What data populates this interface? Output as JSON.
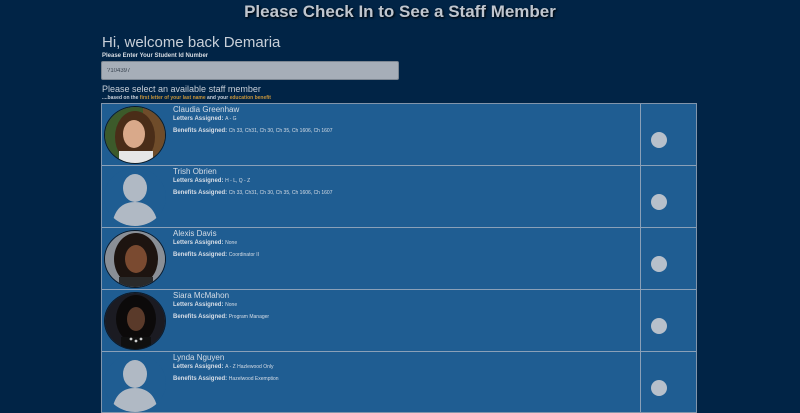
{
  "header": {
    "title": "Please Check In to See a Staff Member"
  },
  "welcome": {
    "text": "Hi, welcome back Demaria"
  },
  "student_id": {
    "label": "Please Enter Your Student Id Number",
    "value": "?104397"
  },
  "selection": {
    "prompt": "Please select an available staff member",
    "hint_prefix": "....based on the ",
    "hint_highlight_1": "first letter of your last name",
    "hint_middle": " and your ",
    "hint_highlight_2": "education benefit"
  },
  "labels": {
    "letters": "Letters Assigned:",
    "benefits": "Benefits Assigned:"
  },
  "colors": {
    "background": "#012446",
    "table_background": "#1f5d92",
    "hint_highlight": "#c7953b"
  },
  "staff": [
    {
      "name": "Claudia Greenhaw",
      "letters": "A - G",
      "benefits": "Ch 33, Ch31, Ch 30, Ch 35, Ch 1606, Ch 1607",
      "avatar": "photo-woman-brown-hair"
    },
    {
      "name": "Trish Obrien",
      "letters": "H - L, Q - Z",
      "benefits": "Ch 33, Ch31, Ch 30, Ch 35, Ch 1606, Ch 1607",
      "avatar": "placeholder-person-icon"
    },
    {
      "name": "Alexis Davis",
      "letters": "None",
      "benefits": "Coordinator II",
      "avatar": "photo-woman-dark-hair"
    },
    {
      "name": "Siara McMahon",
      "letters": "None",
      "benefits": "Program Manager",
      "avatar": "photo-woman-black-hair"
    },
    {
      "name": "Lynda Nguyen",
      "letters": "A - Z Hazlewood Only",
      "benefits": "Hazelwood Exemption",
      "avatar": "placeholder-person-icon"
    }
  ]
}
